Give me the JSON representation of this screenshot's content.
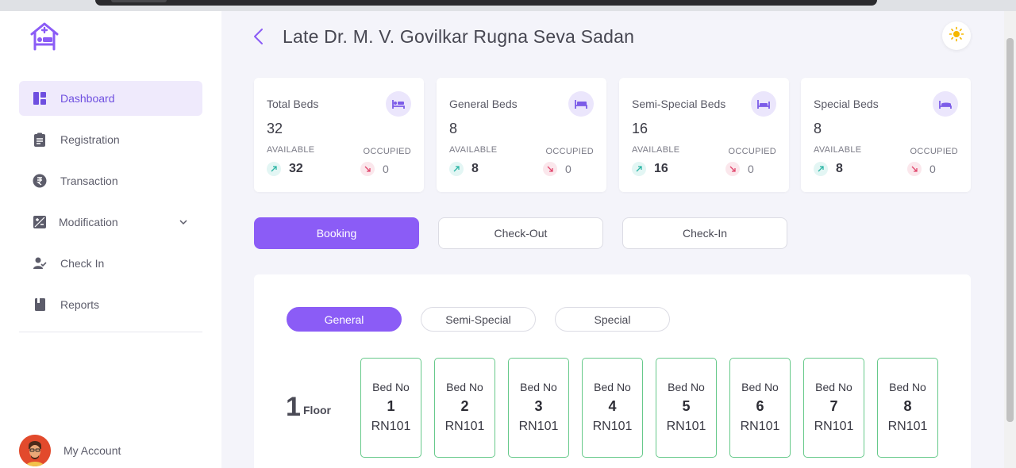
{
  "header": {
    "title": "Late Dr. M. V. Govilkar Rugna Seva Sadan"
  },
  "sidebar": {
    "items": [
      {
        "label": "Dashboard",
        "icon": "dashboard-icon",
        "active": true
      },
      {
        "label": "Registration",
        "icon": "clipboard-icon"
      },
      {
        "label": "Transaction",
        "icon": "rupee-icon"
      },
      {
        "label": "Modification",
        "icon": "plus-minus-icon"
      },
      {
        "label": "Check In",
        "icon": "user-check-icon"
      },
      {
        "label": "Reports",
        "icon": "book-icon"
      }
    ],
    "account_label": "My Account"
  },
  "stats": [
    {
      "title": "Total Beds",
      "total": "32",
      "available_label": "AVAILABLE",
      "occupied_label": "OCCUPIED",
      "available": "32",
      "occupied": "0",
      "icon": "bed-icon"
    },
    {
      "title": "General Beds",
      "total": "8",
      "available_label": "AVAILABLE",
      "occupied_label": "OCCUPIED",
      "available": "8",
      "occupied": "0",
      "icon": "bed-icon"
    },
    {
      "title": "Semi-Special Beds",
      "total": "16",
      "available_label": "AVAILABLE",
      "occupied_label": "OCCUPIED",
      "available": "16",
      "occupied": "0",
      "icon": "bed-icon"
    },
    {
      "title": "Special Beds",
      "total": "8",
      "available_label": "AVAILABLE",
      "occupied_label": "OCCUPIED",
      "available": "8",
      "occupied": "0",
      "icon": "bed-icon"
    }
  ],
  "actions": {
    "booking": "Booking",
    "checkout": "Check-Out",
    "checkin": "Check-In"
  },
  "bed_types": {
    "general": "General",
    "semi_special": "Semi-Special",
    "special": "Special"
  },
  "floor": {
    "number": "1",
    "label": "Floor"
  },
  "beds": [
    {
      "label": "Bed No",
      "number": "1",
      "room": "RN101"
    },
    {
      "label": "Bed No",
      "number": "2",
      "room": "RN101"
    },
    {
      "label": "Bed No",
      "number": "3",
      "room": "RN101"
    },
    {
      "label": "Bed No",
      "number": "4",
      "room": "RN101"
    },
    {
      "label": "Bed No",
      "number": "5",
      "room": "RN101"
    },
    {
      "label": "Bed No",
      "number": "6",
      "room": "RN101"
    },
    {
      "label": "Bed No",
      "number": "7",
      "room": "RN101"
    },
    {
      "label": "Bed No",
      "number": "8",
      "room": "RN101"
    }
  ],
  "colors": {
    "accent": "#8b5cf6",
    "accent_light": "#efeafc",
    "available_green": "#2bb5a5",
    "occupied_red": "#e0456b",
    "bed_border": "#66c98a"
  }
}
